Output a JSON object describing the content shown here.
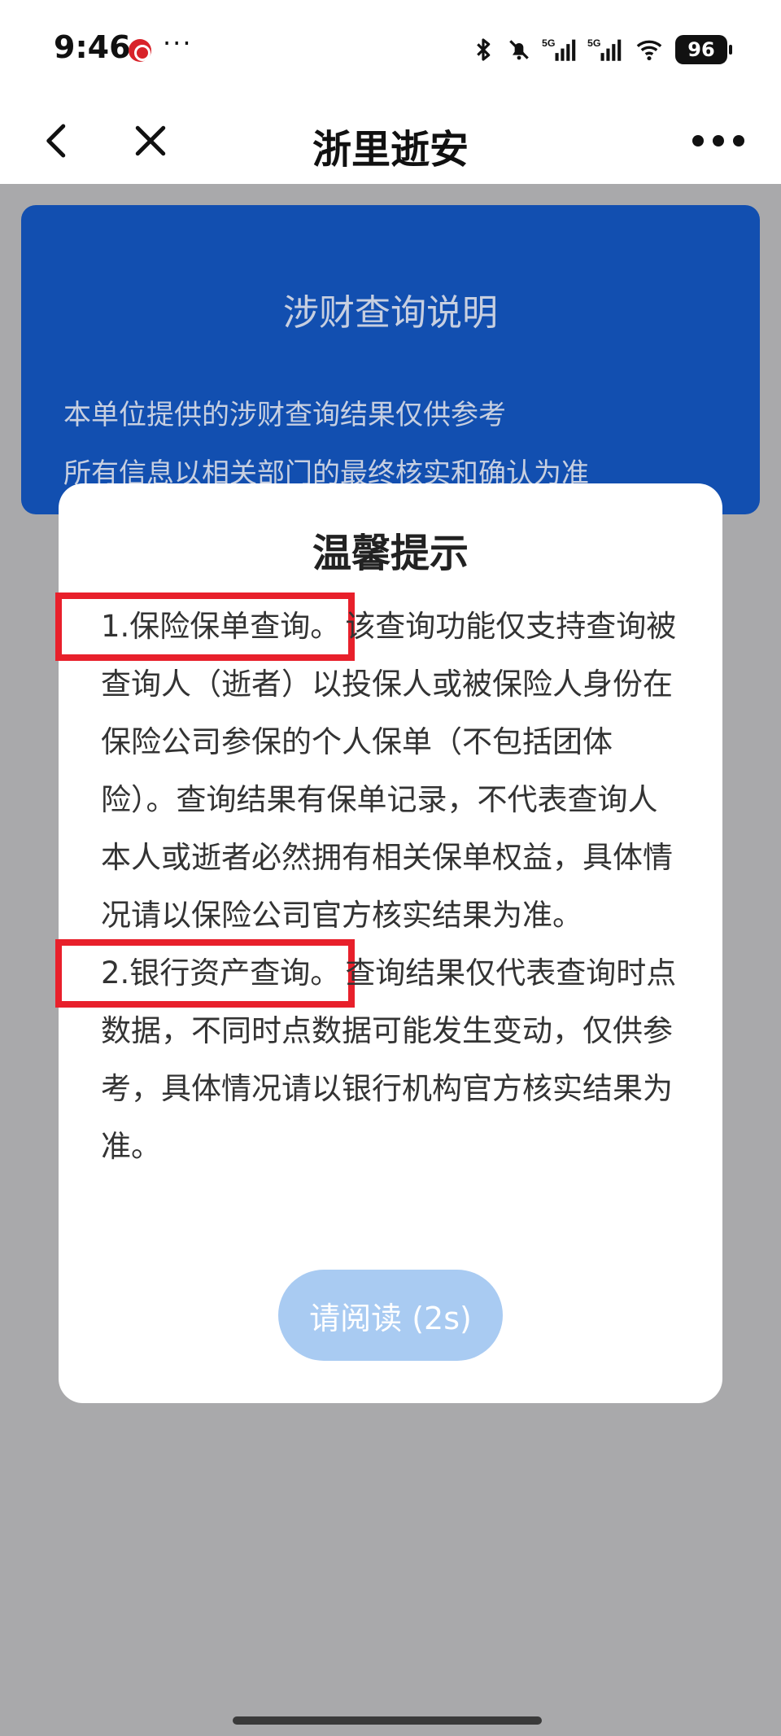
{
  "status_bar": {
    "time": "9:46",
    "more": "···",
    "battery": "96",
    "icons": [
      "app-notification-icon",
      "bluetooth-icon",
      "mute-icon",
      "signal-5g-icon",
      "signal-5g-icon",
      "wifi-icon",
      "battery-icon"
    ]
  },
  "header": {
    "title": "浙里逝安",
    "back_icon": "chevron-left-icon",
    "close_icon": "close-icon",
    "menu_icon": "more-horizontal-icon"
  },
  "info_card": {
    "title": "涉财查询说明",
    "line1": "本单位提供的涉财查询结果仅供参考",
    "line2": "所有信息以相关部门的最终核实和确认为准"
  },
  "dialog": {
    "title": "温馨提示",
    "item1_heading": "1.保险保单查询。",
    "item1_text": "该查询功能仅支持查询被查询人（逝者）以投保人或被保险人身份在保险公司参保的个人保单（不包括团体险）。查询结果有保单记录，不代表查询人本人或逝者必然拥有相关保单权益，具体情况请以保险公司官方核实结果为准。",
    "item2_heading": "2.银行资产查询。",
    "item2_text": "查询结果仅代表查询时点数据，不同时点数据可能发生变动，仅供参考，具体情况请以银行机构官方核实结果为准。",
    "button_label": "请阅读 (2s)"
  },
  "colors": {
    "card_blue": "#124fb0",
    "overlay_gray": "#a9a9ab",
    "highlight_red": "#e8202b",
    "button_disabled_blue": "#a9cbf2"
  }
}
